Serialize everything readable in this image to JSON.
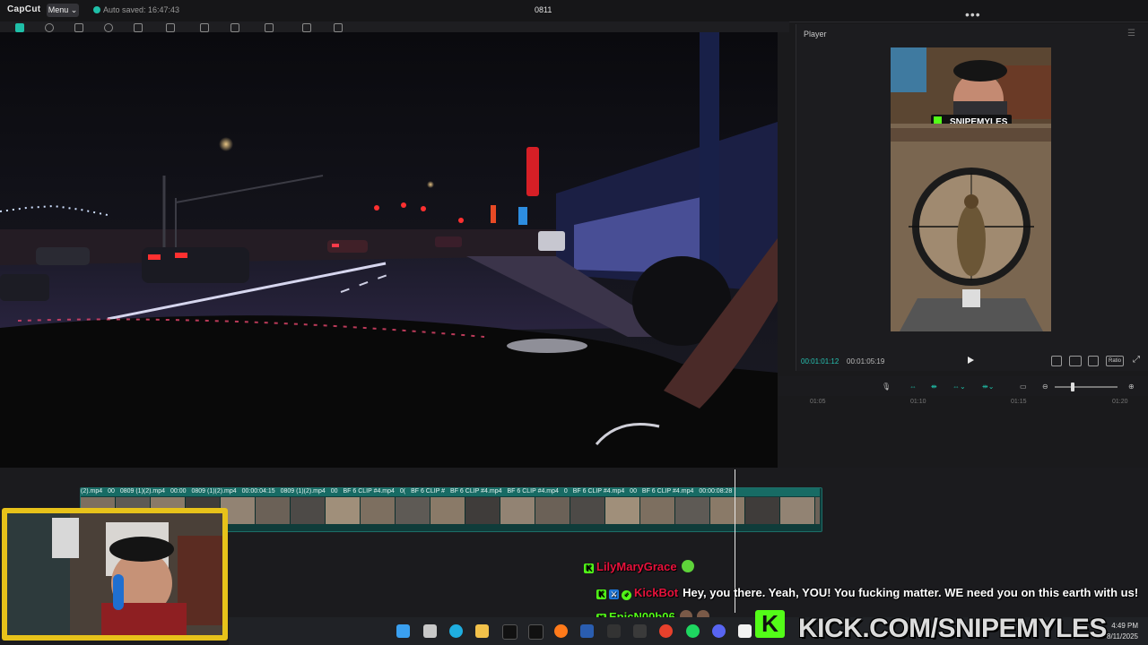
{
  "app": {
    "logo": "CapCut",
    "menu_label": "Menu ⌄",
    "autosave": "Auto saved: 16:47:43",
    "project_title": "0811"
  },
  "player": {
    "title": "Player",
    "more": "•••",
    "time_current": "00:01:01:12",
    "time_total": "00:01:05:19",
    "ratio_label": "Ratio",
    "preview_overlay_name": "SNIPEMYLES"
  },
  "timeline": {
    "ruler": [
      "01:05",
      "01:10",
      "01:15",
      "01:20"
    ],
    "clip_labels": [
      "(2).mp4",
      "00",
      "0809 (1)(2).mp4",
      "00:00",
      "0809 (1)(2).mp4",
      "00:00:04:15",
      "0809 (1)(2).mp4",
      "00",
      "BF 6 CLIP #4.mp4",
      "0(",
      "BF 6 CLIP #",
      "BF 6 CLIP #4.mp4",
      "BF 6 CLIP #4.mp4",
      "0",
      "BF 6 CLIP #4.mp4",
      "00",
      "BF 6 CLIP #4.mp4",
      "00:00:08:28"
    ]
  },
  "chat": [
    {
      "user": "LilyMaryGrace",
      "user_color": "#e8123c",
      "message": ""
    },
    {
      "user": "KickBot",
      "user_color": "#e8123c",
      "message": "Hey, you there. Yeah, YOU! You fucking matter. WE need you on this earth with us!"
    },
    {
      "user": "EpicN00b06",
      "user_color": "#53fc18",
      "message": ""
    }
  ],
  "stream": {
    "kick_letter": "K",
    "kick_url": "KICK.COM/SNIPEMYLES"
  },
  "taskbar": {
    "time": "4:49 PM",
    "date": "8/11/2025",
    "icons": [
      "windows-icon",
      "task-view-icon",
      "edge-icon",
      "file-explorer-icon",
      "x-icon",
      "tiktok-icon",
      "firefox-icon",
      "mobi-icon",
      "terminal-icon",
      "xbox-icon",
      "chrome-icon",
      "spotify-icon",
      "discord-icon",
      "capcut-icon"
    ]
  },
  "colors": {
    "accent": "#1fbfa8",
    "kick_green": "#53fc18",
    "webcam_frame": "#e7c21a"
  }
}
